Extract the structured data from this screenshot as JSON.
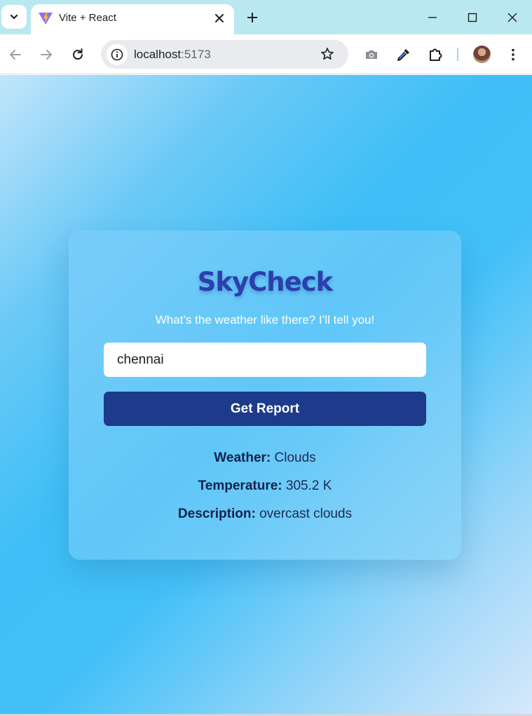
{
  "browser": {
    "tab_title": "Vite + React",
    "url_host": "localhost",
    "url_port": ":5173",
    "icons": [
      "tab-list-icon",
      "vite-favicon",
      "close-icon",
      "new-tab-icon",
      "minimize-icon",
      "maximize-icon",
      "window-close-icon",
      "back-icon",
      "forward-icon",
      "reload-icon",
      "site-info-icon",
      "star-icon",
      "camera-icon",
      "eyedropper-icon",
      "extensions-icon",
      "profile-avatar",
      "more-menu-icon"
    ]
  },
  "app": {
    "title": "SkyCheck",
    "subtitle": "What’s the weather like there? I’ll tell you!",
    "city_value": "chennai",
    "button_label": "Get Report",
    "weather_label": "Weather:",
    "weather_value": "Clouds",
    "temperature_label": "Temperature:",
    "temperature_value": "305.2 K",
    "description_label": "Description:",
    "description_value": "overcast clouds"
  },
  "colors": {
    "title": "#2b3fae",
    "button_bg": "#1e3a8a",
    "tabbar_bg": "#b9e8f1",
    "page_gradient": [
      "#c2e6fb",
      "#3ebff7",
      "#d7e8fb"
    ]
  }
}
